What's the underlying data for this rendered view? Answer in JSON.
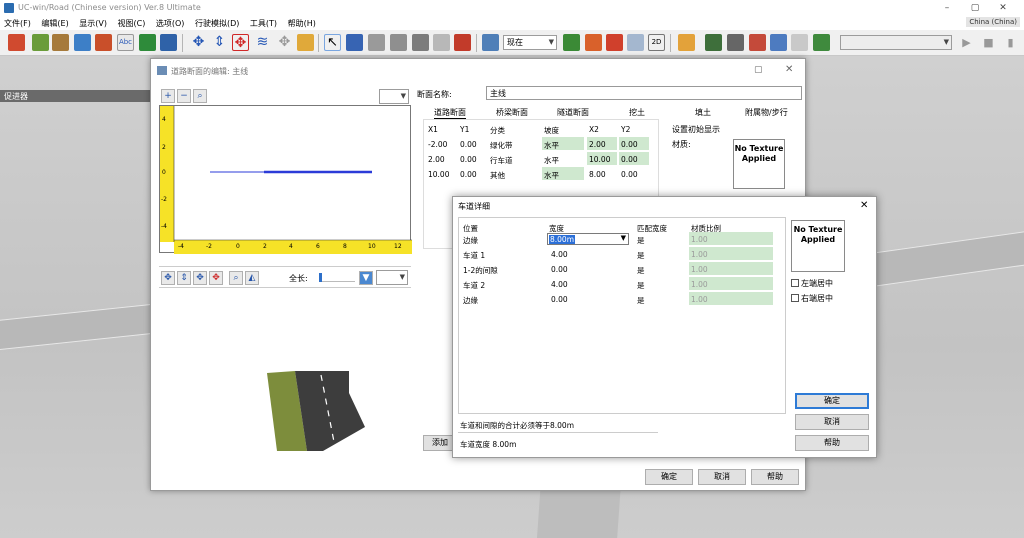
{
  "app": {
    "title": "UC-win/Road (Chinese version) Ver.8 Ultimate",
    "locale": "China (China)",
    "menu": [
      "文件(F)",
      "编辑(E)",
      "显示(V)",
      "视图(C)",
      "选项(O)",
      "行驶模拟(D)",
      "工具(T)",
      "帮助(H)"
    ],
    "toolbar": {
      "time_combo": "现在",
      "label_2d": "2D"
    },
    "side_label": "促进器"
  },
  "dialog1": {
    "title": "道路断面的编辑: 主线",
    "section_name_label": "断面名称:",
    "section_name_value": "主线",
    "tabs": [
      "道路断面",
      "桥梁断面",
      "隧道断面",
      "挖土",
      "填土",
      "附属物/步行"
    ],
    "ruler_v": [
      "4",
      "2",
      "0",
      "-2",
      "-4"
    ],
    "ruler_h": [
      "-4",
      "-2",
      "0",
      "2",
      "4",
      "6",
      "8",
      "10",
      "12"
    ],
    "length_label": "全长:",
    "table": {
      "headers": [
        "X1",
        "Y1",
        "分类",
        "坡度",
        "X2",
        "Y2"
      ],
      "rows": [
        [
          "-2.00",
          "0.00",
          "绿化带",
          "水平",
          "2.00",
          "0.00"
        ],
        [
          "2.00",
          "0.00",
          "行车道",
          "水平",
          "10.00",
          "0.00"
        ],
        [
          "10.00",
          "0.00",
          "其他",
          "水平",
          "8.00",
          "0.00"
        ]
      ]
    },
    "initial_display_label": "设置初始显示",
    "material_label": "材质:",
    "texture_text": "No Texture Applied",
    "add_button": "添加",
    "ok": "确定",
    "cancel": "取消",
    "help": "帮助"
  },
  "dialog2": {
    "title": "车道详细",
    "headers": [
      "位置",
      "宽度",
      "匹配宽度",
      "材质比例"
    ],
    "rows": [
      {
        "pos": "边缘",
        "width": "8.00m",
        "match": "是",
        "ratio": "1.00"
      },
      {
        "pos": "车道 1",
        "width": "4.00",
        "match": "是",
        "ratio": "1.00"
      },
      {
        "pos": "1-2的间隙",
        "width": "0.00",
        "match": "是",
        "ratio": "1.00"
      },
      {
        "pos": "车道 2",
        "width": "4.00",
        "match": "是",
        "ratio": "1.00"
      },
      {
        "pos": "边缘",
        "width": "0.00",
        "match": "是",
        "ratio": "1.00"
      }
    ],
    "texture_text": "No Texture Applied",
    "chk_left": "左端居中",
    "chk_right": "右端居中",
    "status1": "车道和间隙的合计必须等于8.00m",
    "status2": "车道宽度 8.00m",
    "ok": "确定",
    "cancel": "取消",
    "help": "帮助"
  }
}
